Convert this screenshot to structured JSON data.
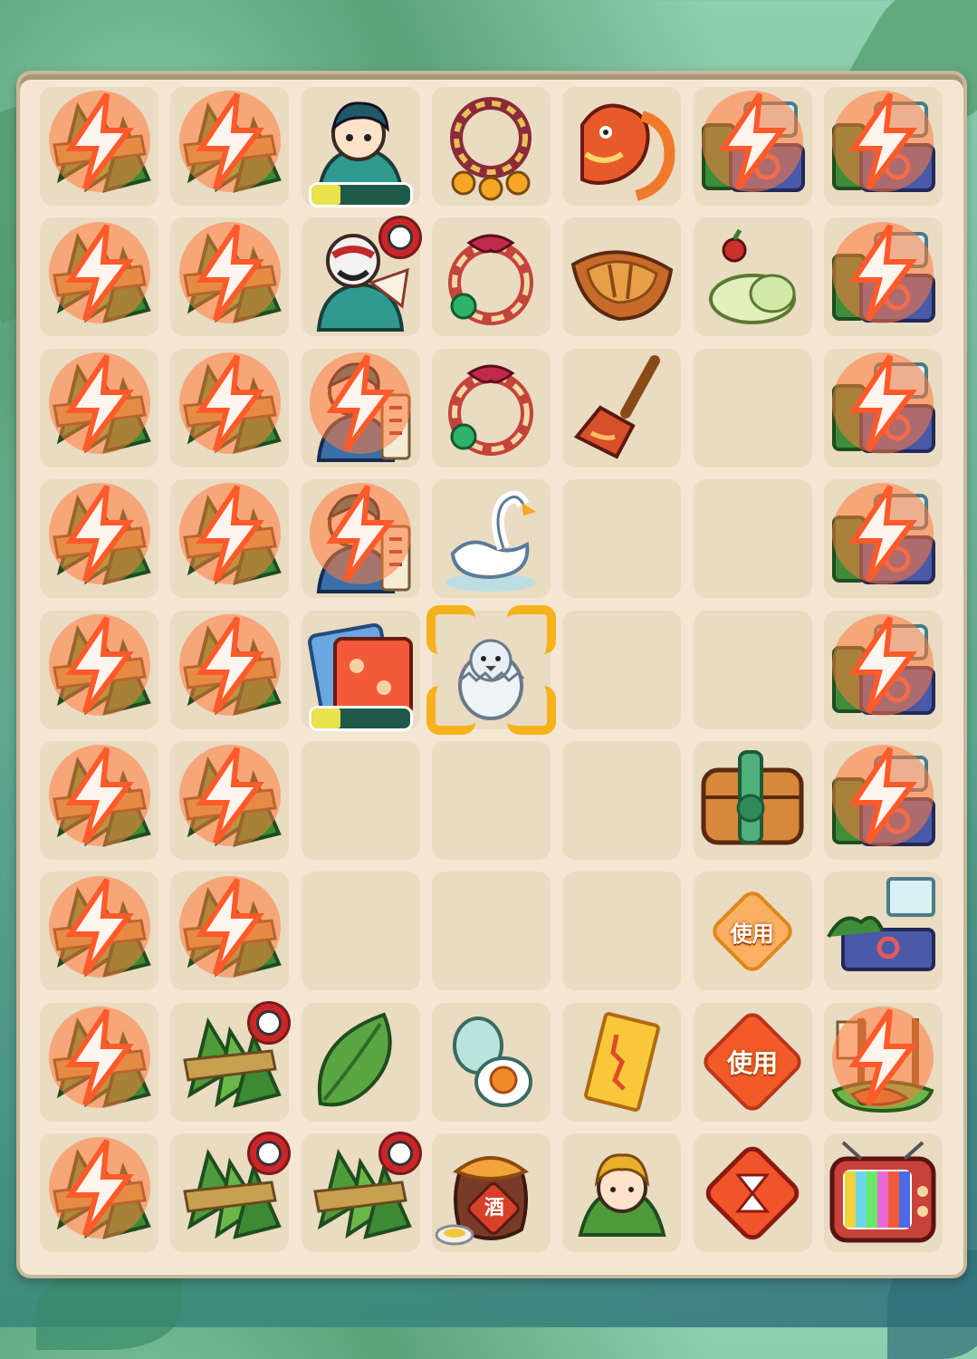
{
  "colors": {
    "board_bg": "#f3e7d4",
    "cell_bg": "#eadbc3",
    "energy_bolt": "#ff6a3d",
    "progress_fill": "#e9e24a",
    "progress_track": "#1f5a48",
    "selection": "#f6b21a",
    "timer": "#c9262a"
  },
  "board": {
    "columns": 7,
    "rows": 9,
    "cells": [
      [
        {
          "item": "zongzi-icon",
          "energy": true
        },
        {
          "item": "zongzi-icon",
          "energy": true
        },
        {
          "item": "scholar-character-icon",
          "progress": 0.3
        },
        {
          "item": "bell-bracelet-icon"
        },
        {
          "item": "dragon-head-icon"
        },
        {
          "item": "reed-stall-generator-icon",
          "energy": true
        },
        {
          "item": "reed-stall-generator-icon",
          "energy": true
        }
      ],
      [
        {
          "item": "zongzi-icon",
          "energy": true
        },
        {
          "item": "zongzi-icon",
          "energy": true
        },
        {
          "item": "opera-character-icon",
          "timer": true
        },
        {
          "item": "jade-bracelet-icon"
        },
        {
          "item": "dragon-boat-icon"
        },
        {
          "item": "rice-dumpling-bun-icon"
        },
        {
          "item": "reed-stall-generator-icon",
          "energy": true
        }
      ],
      [
        {
          "item": "zongzi-icon",
          "energy": true
        },
        {
          "item": "zongzi-icon",
          "energy": true
        },
        {
          "item": "calligrapher-character-icon",
          "energy": true
        },
        {
          "item": "jade-bracelet-icon"
        },
        {
          "item": "paddle-icon"
        },
        {
          "item": null
        },
        {
          "item": "reed-stall-generator-icon",
          "energy": true
        }
      ],
      [
        {
          "item": "zongzi-icon",
          "energy": true
        },
        {
          "item": "zongzi-icon",
          "energy": true
        },
        {
          "item": "calligrapher-character-icon",
          "energy": true
        },
        {
          "item": "swan-icon"
        },
        {
          "item": null
        },
        {
          "item": null
        },
        {
          "item": "reed-stall-generator-icon",
          "energy": true
        }
      ],
      [
        {
          "item": "zongzi-icon",
          "energy": true
        },
        {
          "item": "zongzi-icon",
          "energy": true
        },
        {
          "item": "red-envelope-icon",
          "progress": 0.3
        },
        {
          "item": "hatching-egg-icon",
          "selected": true
        },
        {
          "item": null
        },
        {
          "item": null
        },
        {
          "item": "reed-stall-generator-icon",
          "energy": true
        }
      ],
      [
        {
          "item": "zongzi-icon",
          "energy": true
        },
        {
          "item": "zongzi-icon",
          "energy": true
        },
        {
          "item": null
        },
        {
          "item": null
        },
        {
          "item": null
        },
        {
          "item": "treasure-chest-icon"
        },
        {
          "item": "reed-stall-generator-icon",
          "energy": true
        }
      ],
      [
        {
          "item": "zongzi-icon",
          "energy": true
        },
        {
          "item": "zongzi-icon",
          "energy": true
        },
        {
          "item": null
        },
        {
          "item": null
        },
        {
          "item": null
        },
        {
          "item": "use-token-small-icon",
          "label": "使用"
        },
        {
          "item": "market-stall-icon"
        }
      ],
      [
        {
          "item": "zongzi-icon",
          "energy": true
        },
        {
          "item": "zongzi-icon",
          "timer": true
        },
        {
          "item": "leaf-icon"
        },
        {
          "item": "salted-egg-icon"
        },
        {
          "item": "paper-charm-icon"
        },
        {
          "item": "use-token-icon",
          "label": "使用"
        },
        {
          "item": "boat-workshop-icon",
          "energy": true
        }
      ],
      [
        {
          "item": "zongzi-icon",
          "energy": true
        },
        {
          "item": "zongzi-icon",
          "timer": true
        },
        {
          "item": "zongzi-icon",
          "timer": true
        },
        {
          "item": "wine-jar-icon",
          "text": "酒"
        },
        {
          "item": "zongzi-baby-icon"
        },
        {
          "item": "hourglass-token-icon"
        },
        {
          "item": "tv-icon"
        }
      ]
    ]
  }
}
